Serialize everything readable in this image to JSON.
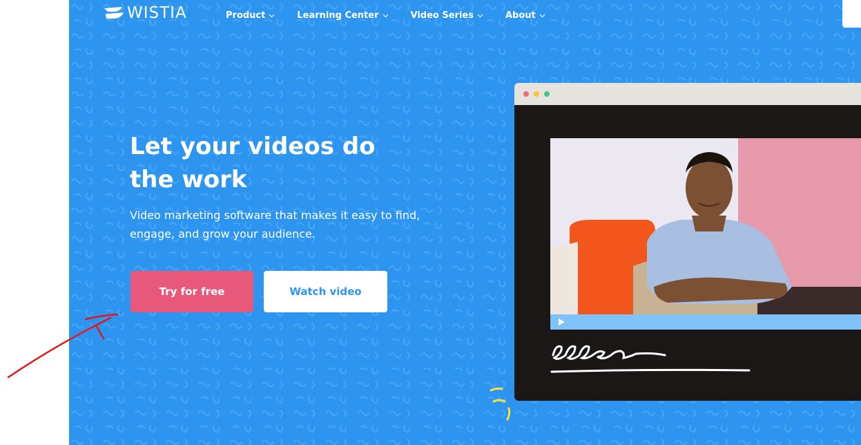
{
  "brand": {
    "name": "WISTIA",
    "logo_icon": "wistia-logo-icon"
  },
  "nav": {
    "items": [
      {
        "label": "Product",
        "icon": "chevron-down-icon"
      },
      {
        "label": "Learning Center",
        "icon": "chevron-down-icon"
      },
      {
        "label": "Video Series",
        "icon": "chevron-down-icon"
      },
      {
        "label": "About",
        "icon": "chevron-down-icon"
      }
    ]
  },
  "hero": {
    "headline": "Let your videos do the work",
    "subhead": "Video marketing software that makes it easy to find, engage, and grow your audience.",
    "primary_cta": "Try for free",
    "secondary_cta": "Watch video"
  },
  "colors": {
    "hero_background": "#2d95f0",
    "primary_button": "#e8587b",
    "secondary_button_text": "#2d95f0",
    "annotation": "#e01919"
  },
  "mockup": {
    "window_dots": [
      "red",
      "yellow",
      "green"
    ],
    "play_icon": "play-icon",
    "signature_icon": "handwritten-signature-icon"
  }
}
